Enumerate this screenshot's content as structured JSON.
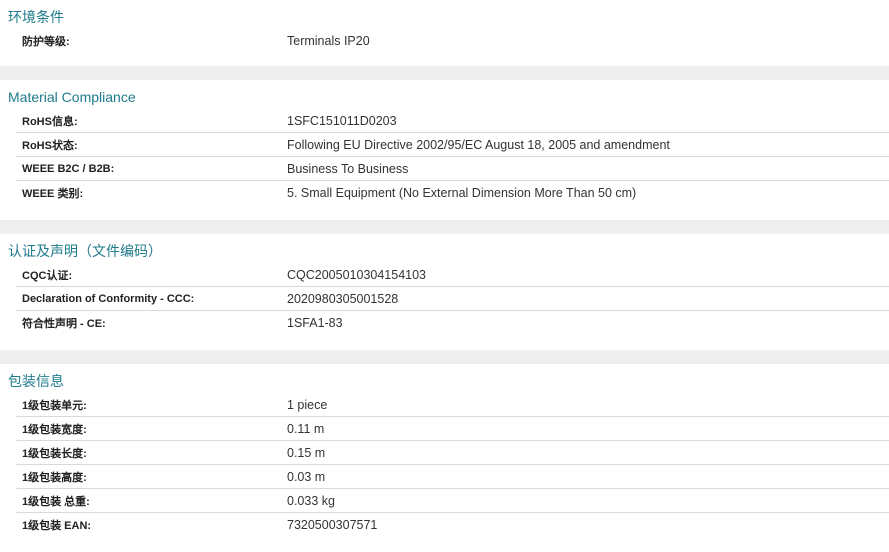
{
  "sections": [
    {
      "title": "环境条件",
      "rows": [
        {
          "label": "防护等级:",
          "value": "Terminals IP20"
        }
      ]
    },
    {
      "title": "Material Compliance",
      "rows": [
        {
          "label": "RoHS信息:",
          "value": "1SFC151011D0203"
        },
        {
          "label": "RoHS状态:",
          "value": "Following EU Directive 2002/95/EC August 18, 2005 and amendment"
        },
        {
          "label": "WEEE B2C / B2B:",
          "value": "Business To Business"
        },
        {
          "label": "WEEE 类别:",
          "value": "5. Small Equipment (No External Dimension More Than 50 cm)"
        }
      ]
    },
    {
      "title": "认证及声明（文件编码）",
      "rows": [
        {
          "label": "CQC认证:",
          "value": "CQC2005010304154103"
        },
        {
          "label": "Declaration of Conformity - CCC:",
          "value": "2020980305001528"
        },
        {
          "label": "符合性声明 - CE:",
          "value": "1SFA1-83"
        }
      ]
    },
    {
      "title": "包装信息",
      "rows": [
        {
          "label": "1级包装单元:",
          "value": "1 piece"
        },
        {
          "label": "1级包装宽度:",
          "value": "0.11 m"
        },
        {
          "label": "1级包装长度:",
          "value": "0.15 m"
        },
        {
          "label": "1级包装高度:",
          "value": "0.03 m"
        },
        {
          "label": "1级包装 总重:",
          "value": "0.033 kg"
        },
        {
          "label": "1级包装 EAN:",
          "value": "7320500307571"
        }
      ]
    }
  ]
}
